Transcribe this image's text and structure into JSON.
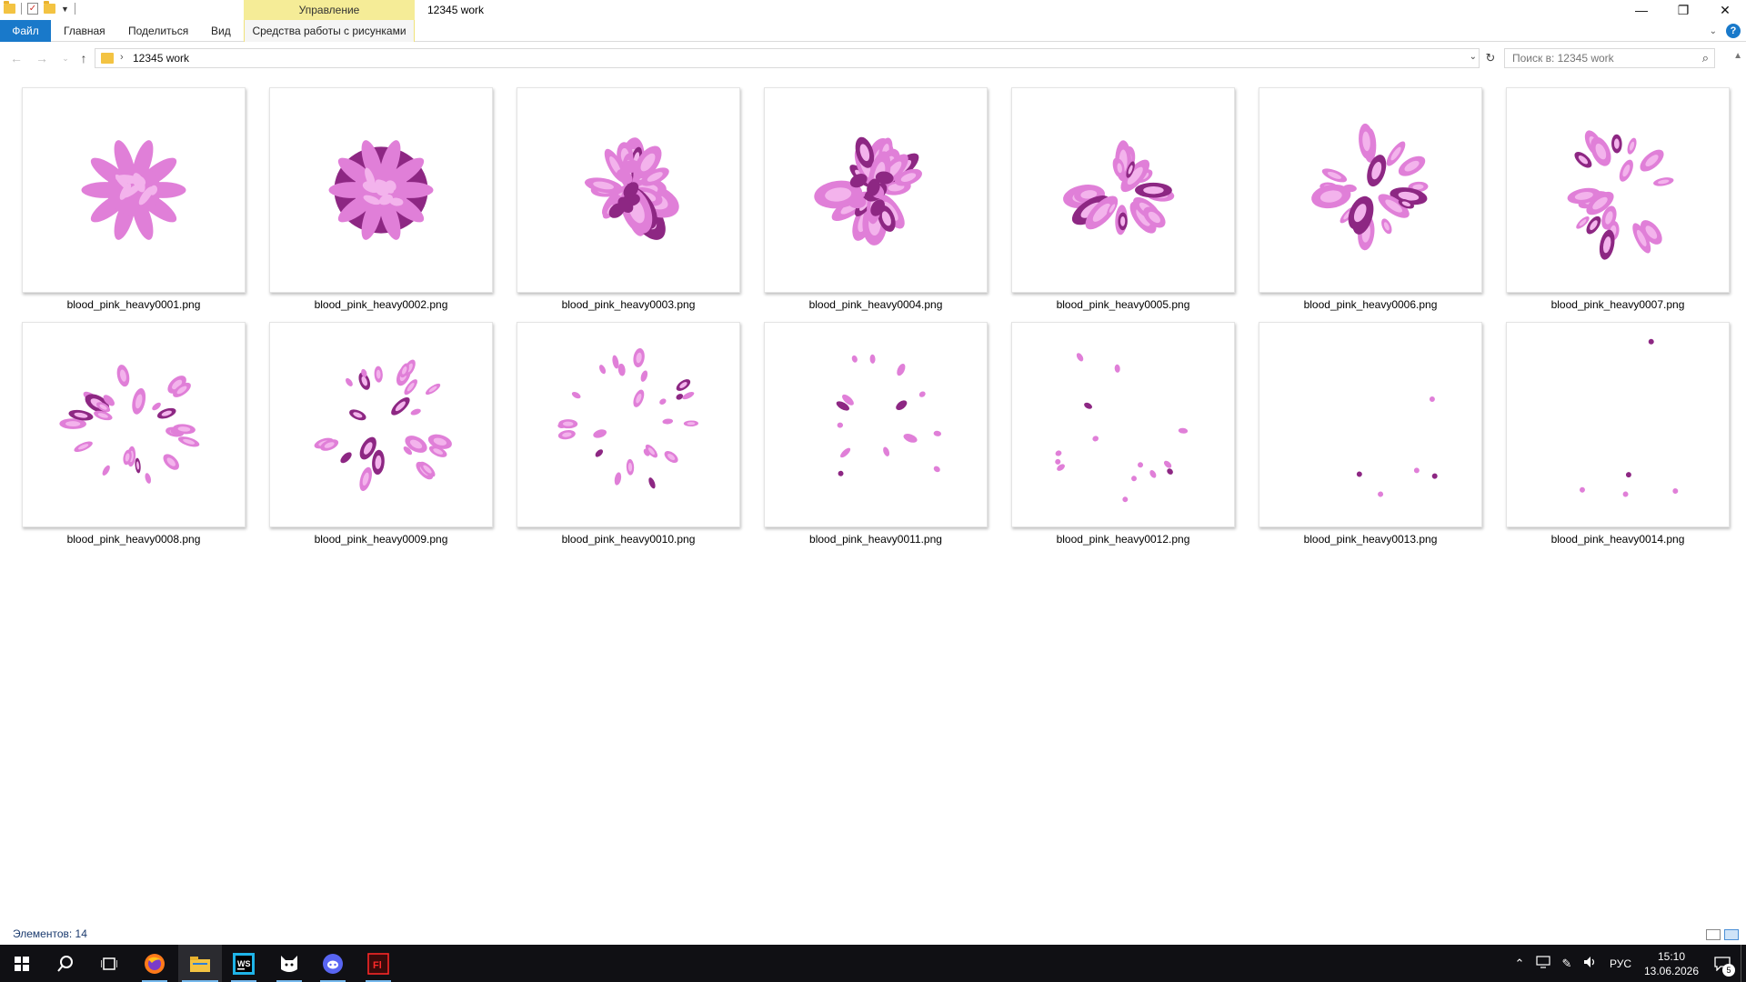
{
  "titlebar": {
    "context_tab_header": "Управление",
    "window_title": "12345 work",
    "minimize": "—",
    "restore": "❐",
    "close": "✕"
  },
  "ribbon": {
    "tabs": [
      "Файл",
      "Главная",
      "Поделиться",
      "Вид"
    ],
    "context_tab": "Средства работы с рисунками"
  },
  "address": {
    "path": "12345 work"
  },
  "search": {
    "placeholder": "Поиск в: 12345 work"
  },
  "files": [
    {
      "name": "blood_pink_heavy0001.png",
      "frame": 1
    },
    {
      "name": "blood_pink_heavy0002.png",
      "frame": 2
    },
    {
      "name": "blood_pink_heavy0003.png",
      "frame": 3
    },
    {
      "name": "blood_pink_heavy0004.png",
      "frame": 4
    },
    {
      "name": "blood_pink_heavy0005.png",
      "frame": 5
    },
    {
      "name": "blood_pink_heavy0006.png",
      "frame": 6
    },
    {
      "name": "blood_pink_heavy0007.png",
      "frame": 7
    },
    {
      "name": "blood_pink_heavy0008.png",
      "frame": 8
    },
    {
      "name": "blood_pink_heavy0009.png",
      "frame": 9
    },
    {
      "name": "blood_pink_heavy0010.png",
      "frame": 10
    },
    {
      "name": "blood_pink_heavy0011.png",
      "frame": 11
    },
    {
      "name": "blood_pink_heavy0012.png",
      "frame": 12
    },
    {
      "name": "blood_pink_heavy0013.png",
      "frame": 13
    },
    {
      "name": "blood_pink_heavy0014.png",
      "frame": 14
    }
  ],
  "status": {
    "items_label": "Элементов: 14"
  },
  "colors": {
    "accent": "#1979ca",
    "context_tab": "#f5ec97",
    "splash_light": "#e07fd8",
    "splash_pale": "#f3b3ec",
    "splash_dark": "#8d2783"
  },
  "taskbar": {
    "apps": [
      {
        "icon": "windows-start-icon"
      },
      {
        "icon": "search-icon"
      },
      {
        "icon": "task-view-icon"
      },
      {
        "icon": "firefox-icon"
      },
      {
        "icon": "file-explorer-icon"
      },
      {
        "icon": "webstorm-icon",
        "label": "WS"
      },
      {
        "icon": "cat-app-icon"
      },
      {
        "icon": "discord-icon"
      },
      {
        "icon": "flash-icon",
        "label": "Fl"
      }
    ],
    "language": "РУС",
    "time": "15:10",
    "date": "13.06.2026",
    "notification_count": "5"
  }
}
